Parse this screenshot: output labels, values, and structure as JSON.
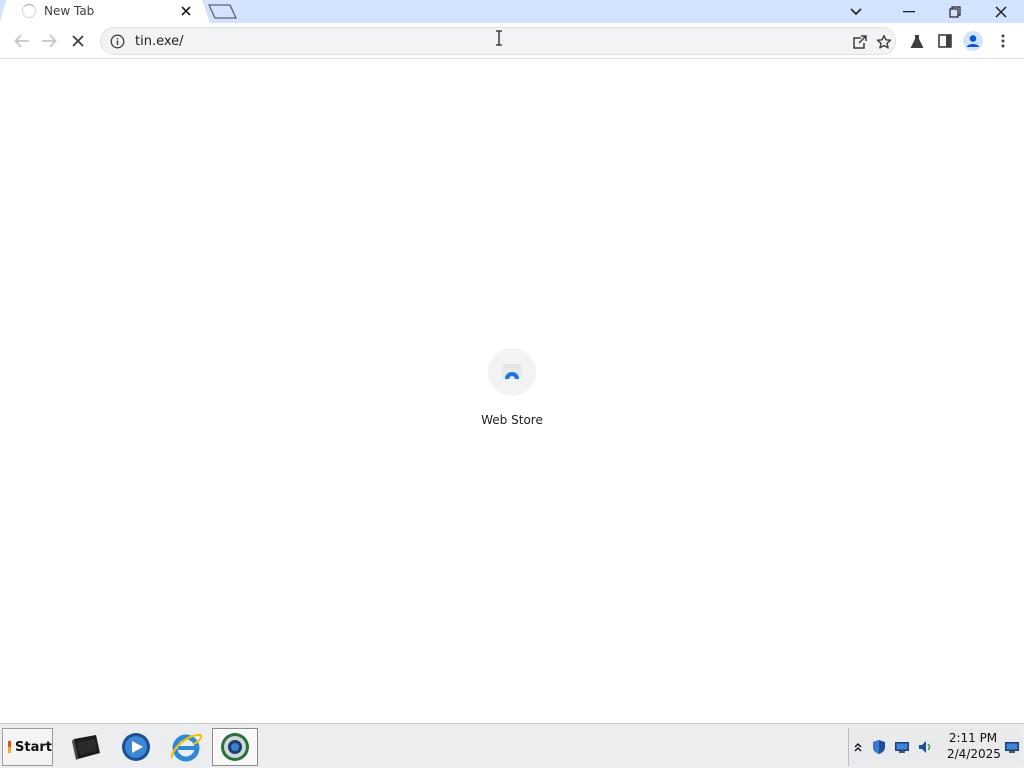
{
  "browser": {
    "tab": {
      "title": "New Tab"
    },
    "omnibox": {
      "url": "tin.exe/"
    }
  },
  "content": {
    "shortcuts": [
      {
        "label": "Web Store",
        "icon": "web-store-icon"
      }
    ]
  },
  "taskbar": {
    "start_label": "Start",
    "apps": [
      {
        "name": "terminal-icon"
      },
      {
        "name": "media-player-icon"
      },
      {
        "name": "internet-explorer-icon"
      },
      {
        "name": "chrome-icon",
        "active": true
      }
    ],
    "clock": {
      "time": "2:11 PM",
      "date": "2/4/2025"
    }
  },
  "colors": {
    "tabstrip": "#d3e3fd",
    "omnibox_bg": "#f1f3f4",
    "accent_blue": "#1a73e8",
    "taskbar": "#ecedef"
  }
}
